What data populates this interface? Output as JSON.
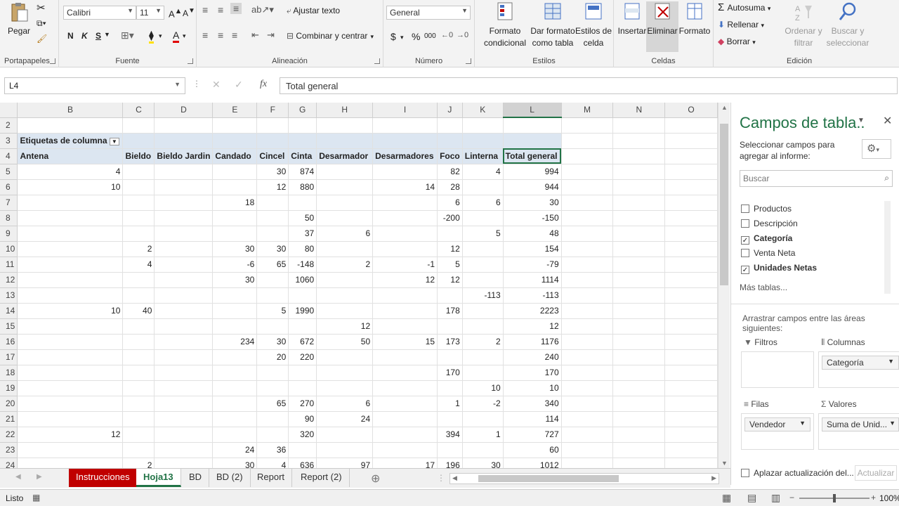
{
  "ribbon": {
    "clipboard": {
      "paste": "Pegar",
      "label": "Portapapeles"
    },
    "font": {
      "name": "Calibri",
      "size": "11",
      "bold": "N",
      "italic": "K",
      "underline": "S",
      "label": "Fuente"
    },
    "alignment": {
      "wrap": "Ajustar texto",
      "merge": "Combinar y centrar",
      "label": "Alineación"
    },
    "number": {
      "format": "General",
      "currency": "$",
      "percent": "%",
      "thousands": "000",
      "label": "Número"
    },
    "styles": {
      "conditional": "Formato condicional",
      "table": "Dar formato como tabla",
      "cell": "Estilos de celda",
      "label": "Estilos"
    },
    "cells": {
      "insert": "Insertar",
      "delete": "Eliminar",
      "format": "Formato",
      "label": "Celdas"
    },
    "editing": {
      "autosum": "Autosuma",
      "fill": "Rellenar",
      "clear": "Borrar",
      "sort": "Ordenar y filtrar",
      "find": "Buscar y seleccionar",
      "label": "Edición"
    }
  },
  "formula_bar": {
    "name_box": "L4",
    "fx": "fx",
    "value": "Total general"
  },
  "columns": [
    "B",
    "C",
    "D",
    "E",
    "F",
    "G",
    "H",
    "I",
    "J",
    "K",
    "L",
    "M",
    "N",
    "O"
  ],
  "pivot": {
    "col_label_header": "Etiquetas de columna",
    "headers": [
      "Antena",
      "Bieldo",
      "Bieldo Jardin",
      "Candado",
      "Cincel",
      "Cinta",
      "Desarmador",
      "Desarmadores",
      "Foco",
      "Linterna",
      "Total general"
    ]
  },
  "rows": [
    {
      "n": "2",
      "v": [
        "",
        "",
        "",
        "",
        "",
        "",
        "",
        "",
        "",
        "",
        ""
      ]
    },
    {
      "n": "5",
      "v": [
        "4",
        "",
        "",
        "",
        "30",
        "874",
        "",
        "",
        "82",
        "4",
        "994"
      ]
    },
    {
      "n": "6",
      "v": [
        "10",
        "",
        "",
        "",
        "12",
        "880",
        "",
        "14",
        "28",
        "",
        "944"
      ]
    },
    {
      "n": "7",
      "v": [
        "",
        "",
        "",
        "18",
        "",
        "",
        "",
        "",
        "6",
        "6",
        "30"
      ]
    },
    {
      "n": "8",
      "v": [
        "",
        "",
        "",
        "",
        "",
        "50",
        "",
        "",
        "-200",
        "",
        "-150"
      ]
    },
    {
      "n": "9",
      "v": [
        "",
        "",
        "",
        "",
        "",
        "37",
        "6",
        "",
        "",
        "5",
        "48"
      ]
    },
    {
      "n": "10",
      "v": [
        "",
        "2",
        "",
        "30",
        "30",
        "80",
        "",
        "",
        "12",
        "",
        "154"
      ]
    },
    {
      "n": "11",
      "v": [
        "",
        "4",
        "",
        "-6",
        "65",
        "-148",
        "2",
        "-1",
        "5",
        "",
        "-79"
      ]
    },
    {
      "n": "12",
      "v": [
        "",
        "",
        "",
        "30",
        "",
        "1060",
        "",
        "12",
        "12",
        "",
        "1114"
      ]
    },
    {
      "n": "13",
      "v": [
        "",
        "",
        "",
        "",
        "",
        "",
        "",
        "",
        "",
        "-113",
        "-113"
      ]
    },
    {
      "n": "14",
      "v": [
        "10",
        "40",
        "",
        "",
        "5",
        "1990",
        "",
        "",
        "178",
        "",
        "2223"
      ]
    },
    {
      "n": "15",
      "v": [
        "",
        "",
        "",
        "",
        "",
        "",
        "12",
        "",
        "",
        "",
        "12"
      ]
    },
    {
      "n": "16",
      "v": [
        "",
        "",
        "",
        "234",
        "30",
        "672",
        "50",
        "15",
        "173",
        "2",
        "1176"
      ]
    },
    {
      "n": "17",
      "v": [
        "",
        "",
        "",
        "",
        "20",
        "220",
        "",
        "",
        "",
        "",
        "240"
      ]
    },
    {
      "n": "18",
      "v": [
        "",
        "",
        "",
        "",
        "",
        "",
        "",
        "",
        "170",
        "",
        "170"
      ]
    },
    {
      "n": "19",
      "v": [
        "",
        "",
        "",
        "",
        "",
        "",
        "",
        "",
        "",
        "10",
        "10"
      ]
    },
    {
      "n": "20",
      "v": [
        "",
        "",
        "",
        "",
        "65",
        "270",
        "6",
        "",
        "1",
        "-2",
        "340"
      ]
    },
    {
      "n": "21",
      "v": [
        "",
        "",
        "",
        "",
        "",
        "90",
        "24",
        "",
        "",
        "",
        "114"
      ]
    },
    {
      "n": "22",
      "v": [
        "12",
        "",
        "",
        "",
        "",
        "320",
        "",
        "",
        "394",
        "1",
        "727"
      ]
    },
    {
      "n": "23",
      "v": [
        "",
        "",
        "",
        "24",
        "36",
        "",
        "",
        "",
        "",
        "",
        "60"
      ]
    },
    {
      "n": "24",
      "v": [
        "",
        "2",
        "",
        "30",
        "4",
        "636",
        "97",
        "17",
        "196",
        "30",
        "1012"
      ]
    }
  ],
  "pane": {
    "title": "Campos de tabla..",
    "subtitle": "Seleccionar campos para agregar al informe:",
    "search_placeholder": "Buscar",
    "fields": [
      {
        "label": "Productos",
        "checked": false,
        "bold": false
      },
      {
        "label": "Descripción",
        "checked": false,
        "bold": false
      },
      {
        "label": "Categoría",
        "checked": true,
        "bold": true
      },
      {
        "label": "Venta Neta",
        "checked": false,
        "bold": false
      },
      {
        "label": "Unidades Netas",
        "checked": true,
        "bold": true
      }
    ],
    "more_tables": "Más tablas...",
    "drag_hint": "Arrastrar campos entre las áreas siguientes:",
    "filters": "Filtros",
    "columns": "Columnas",
    "rows": "Filas",
    "values": "Valores",
    "columns_chip": "Categoría",
    "rows_chip": "Vendedor",
    "values_chip": "Suma de Unid...",
    "defer": "Aplazar actualización del...",
    "update": "Actualizar"
  },
  "tabs": [
    "Instrucciones",
    "Hoja13",
    "BD",
    "BD (2)",
    "Report",
    "Report (2)"
  ],
  "status": {
    "ready": "Listo",
    "zoom": "100%"
  }
}
